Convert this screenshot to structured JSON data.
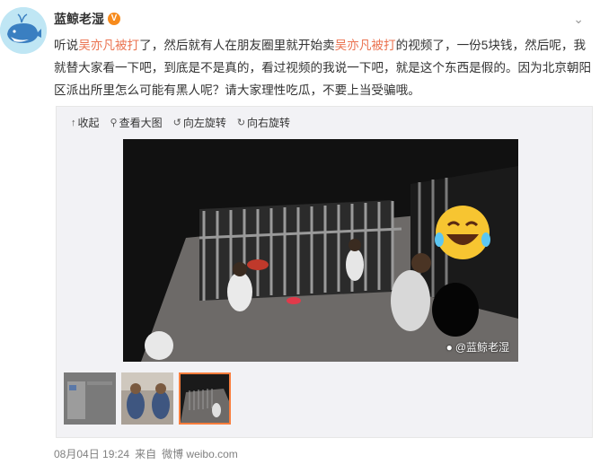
{
  "user": {
    "name": "蓝鲸老湿",
    "verified_badge": "V"
  },
  "post": {
    "segments": [
      {
        "text": "听说",
        "highlight": false
      },
      {
        "text": "吴亦凡被打",
        "highlight": true
      },
      {
        "text": "了，然后就有人在朋友圈里就开始卖",
        "highlight": false
      },
      {
        "text": "吴亦凡被打",
        "highlight": true
      },
      {
        "text": "的视频了，一份5块钱，然后呢，我就替大家看一下吧，到底是不是真的，看过视频的我说一下吧，就是这个东西是假的。因为北京朝阳区派出所里怎么可能有黑人呢？请大家理性吃瓜，不要上当受骗哦。",
        "highlight": false
      }
    ],
    "highlight_color": "#eb7350"
  },
  "media_toolbar": {
    "collapse": "收起",
    "view_large": "查看大图",
    "rotate_left": "向左旋转",
    "rotate_right": "向右旋转"
  },
  "media": {
    "watermark": "@蓝鲸老湿",
    "thumbnail_count": 3,
    "active_thumbnail": 3
  },
  "footer": {
    "date": "08月04日 19:24",
    "source_prefix": "来自",
    "source": "微博 weibo.com"
  },
  "icons": {
    "menu": "chevron-down-icon",
    "collapse": "arrow-up-icon",
    "view_large": "magnifier-icon",
    "rotate_left": "rotate-left-icon",
    "rotate_right": "rotate-right-icon",
    "watermark": "weibo-logo-icon"
  },
  "colors": {
    "accent": "#eb7350",
    "active_thumb_border": "#fa7d3c",
    "verified": "#f78b1d"
  }
}
